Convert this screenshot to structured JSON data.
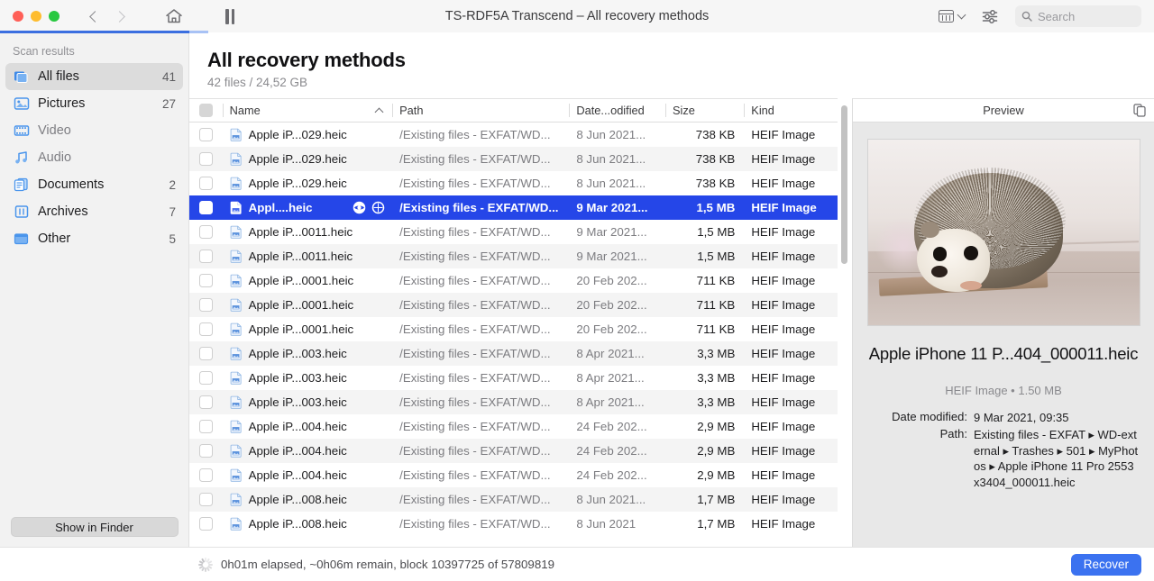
{
  "titlebar": {
    "title": "TS-RDF5A Transcend – All recovery methods",
    "search_placeholder": "Search",
    "back_icon": "chevron-left-icon",
    "forward_icon": "chevron-right-icon",
    "home_icon": "home-icon",
    "pause_icon": "pause-icon",
    "view_icon": "grid-view-icon",
    "filters_icon": "sliders-icon",
    "search_icon": "search-icon"
  },
  "sidebar": {
    "heading": "Scan results",
    "items": [
      {
        "label": "All files",
        "count": "41",
        "icon": "all-files-icon",
        "active": true,
        "dim": false
      },
      {
        "label": "Pictures",
        "count": "27",
        "icon": "pictures-icon",
        "active": false,
        "dim": false
      },
      {
        "label": "Video",
        "count": "",
        "icon": "video-icon",
        "active": false,
        "dim": true
      },
      {
        "label": "Audio",
        "count": "",
        "icon": "audio-icon",
        "active": false,
        "dim": true
      },
      {
        "label": "Documents",
        "count": "2",
        "icon": "documents-icon",
        "active": false,
        "dim": false
      },
      {
        "label": "Archives",
        "count": "7",
        "icon": "archives-icon",
        "active": false,
        "dim": false
      },
      {
        "label": "Other",
        "count": "5",
        "icon": "other-icon",
        "active": false,
        "dim": false
      }
    ],
    "show_in_finder": "Show in Finder"
  },
  "main": {
    "title": "All recovery methods",
    "subtitle": "42 files / 24,52 GB",
    "columns": {
      "name": "Name",
      "path": "Path",
      "date": "Date...odified",
      "size": "Size",
      "kind": "Kind"
    },
    "sort_icon": "sort-ascending-icon",
    "rows": [
      {
        "name": "Apple iP...029.heic",
        "path": "/Existing files - EXFAT/WD...",
        "date": "8 Jun 2021...",
        "size": "738 KB",
        "kind": "HEIF Image",
        "selected": false
      },
      {
        "name": "Apple iP...029.heic",
        "path": "/Existing files - EXFAT/WD...",
        "date": "8 Jun 2021...",
        "size": "738 KB",
        "kind": "HEIF Image",
        "selected": false
      },
      {
        "name": "Apple iP...029.heic",
        "path": "/Existing files - EXFAT/WD...",
        "date": "8 Jun 2021...",
        "size": "738 KB",
        "kind": "HEIF Image",
        "selected": false
      },
      {
        "name": "Appl....heic",
        "path": "/Existing files - EXFAT/WD...",
        "date": "9 Mar 2021...",
        "size": "1,5 MB",
        "kind": "HEIF Image",
        "selected": true
      },
      {
        "name": "Apple iP...0011.heic",
        "path": "/Existing files - EXFAT/WD...",
        "date": "9 Mar 2021...",
        "size": "1,5 MB",
        "kind": "HEIF Image",
        "selected": false
      },
      {
        "name": "Apple iP...0011.heic",
        "path": "/Existing files - EXFAT/WD...",
        "date": "9 Mar 2021...",
        "size": "1,5 MB",
        "kind": "HEIF Image",
        "selected": false
      },
      {
        "name": "Apple iP...0001.heic",
        "path": "/Existing files - EXFAT/WD...",
        "date": "20 Feb 202...",
        "size": "711 KB",
        "kind": "HEIF Image",
        "selected": false
      },
      {
        "name": "Apple iP...0001.heic",
        "path": "/Existing files - EXFAT/WD...",
        "date": "20 Feb 202...",
        "size": "711 KB",
        "kind": "HEIF Image",
        "selected": false
      },
      {
        "name": "Apple iP...0001.heic",
        "path": "/Existing files - EXFAT/WD...",
        "date": "20 Feb 202...",
        "size": "711 KB",
        "kind": "HEIF Image",
        "selected": false
      },
      {
        "name": "Apple iP...003.heic",
        "path": "/Existing files - EXFAT/WD...",
        "date": "8 Apr 2021...",
        "size": "3,3 MB",
        "kind": "HEIF Image",
        "selected": false
      },
      {
        "name": "Apple iP...003.heic",
        "path": "/Existing files - EXFAT/WD...",
        "date": "8 Apr 2021...",
        "size": "3,3 MB",
        "kind": "HEIF Image",
        "selected": false
      },
      {
        "name": "Apple iP...003.heic",
        "path": "/Existing files - EXFAT/WD...",
        "date": "8 Apr 2021...",
        "size": "3,3 MB",
        "kind": "HEIF Image",
        "selected": false
      },
      {
        "name": "Apple iP...004.heic",
        "path": "/Existing files - EXFAT/WD...",
        "date": "24 Feb 202...",
        "size": "2,9 MB",
        "kind": "HEIF Image",
        "selected": false
      },
      {
        "name": "Apple iP...004.heic",
        "path": "/Existing files - EXFAT/WD...",
        "date": "24 Feb 202...",
        "size": "2,9 MB",
        "kind": "HEIF Image",
        "selected": false
      },
      {
        "name": "Apple iP...004.heic",
        "path": "/Existing files - EXFAT/WD...",
        "date": "24 Feb 202...",
        "size": "2,9 MB",
        "kind": "HEIF Image",
        "selected": false
      },
      {
        "name": "Apple iP...008.heic",
        "path": "/Existing files - EXFAT/WD...",
        "date": "8 Jun 2021...",
        "size": "1,7 MB",
        "kind": "HEIF Image",
        "selected": false
      },
      {
        "name": "Apple iP...008.heic",
        "path": "/Existing files - EXFAT/WD...",
        "date": "8 Jun 2021",
        "size": "1,7 MB",
        "kind": "HEIF Image",
        "selected": false
      }
    ],
    "row_preview_icon": "eye-icon",
    "row_locate_icon": "target-icon"
  },
  "preview": {
    "header": "Preview",
    "copy_icon": "copy-icon",
    "image_alt": "hedgehog-photo",
    "filename": "Apple iPhone 11 P...404_000011.heic",
    "meta": "HEIF Image • 1.50 MB",
    "details": [
      {
        "label": "Date modified:",
        "value": "9 Mar 2021, 09:35"
      },
      {
        "label": "Path:",
        "value": "Existing files - EXFAT ▸ WD-external ▸ Trashes ▸ 501 ▸ MyPhotos ▸ Apple iPhone 11 Pro 2553x3404_000011.heic"
      }
    ]
  },
  "statusbar": {
    "status_text": "0h01m elapsed, ~0h06m remain, block 10397725 of 57809819",
    "spinner_icon": "spinner-icon",
    "recover_label": "Recover"
  },
  "colors": {
    "accent_blue": "#3b72f0",
    "selection_blue": "#2546e8",
    "progress_blue": "#3b6fe0",
    "sidebar_bg": "#f2f2f2",
    "preview_bg": "#e8e8e8"
  }
}
